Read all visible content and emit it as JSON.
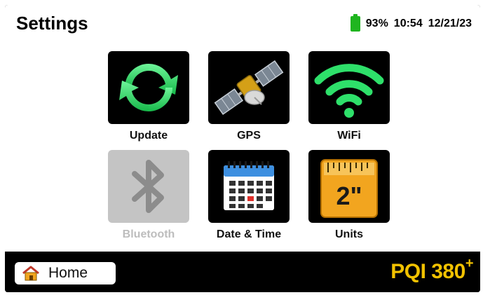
{
  "header": {
    "title": "Settings",
    "battery_percent": "93%",
    "time": "10:54",
    "date": "12/21/23"
  },
  "tiles": [
    {
      "label": "Update",
      "icon": "refresh-arrows-icon",
      "enabled": true
    },
    {
      "label": "GPS",
      "icon": "satellite-icon",
      "enabled": true
    },
    {
      "label": "WiFi",
      "icon": "wifi-icon",
      "enabled": true
    },
    {
      "label": "Bluetooth",
      "icon": "bluetooth-icon",
      "enabled": false
    },
    {
      "label": "Date & Time",
      "icon": "calendar-icon",
      "enabled": true
    },
    {
      "label": "Units",
      "icon": "ruler-icon",
      "enabled": true
    }
  ],
  "units_icon_text": "2\"",
  "footer": {
    "home_label": "Home",
    "brand": "PQI 380",
    "brand_sup": "+"
  },
  "colors": {
    "accent_green": "#2ee06a",
    "brand_yellow": "#f2c200",
    "disabled_gray": "#c4c4c4",
    "battery_green": "#1fb51f"
  }
}
